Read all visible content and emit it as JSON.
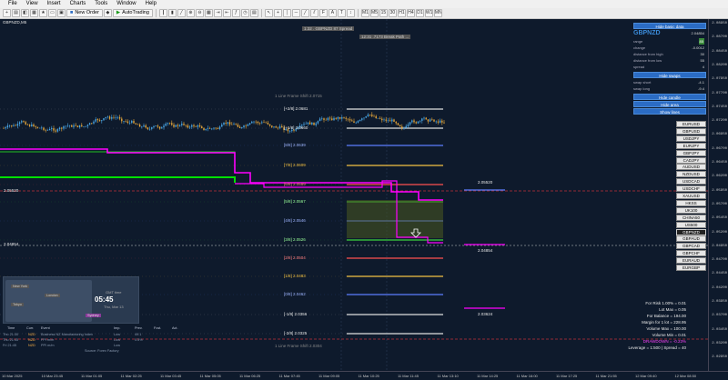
{
  "menu": [
    "File",
    "View",
    "Insert",
    "Charts",
    "Tools",
    "Window",
    "Help"
  ],
  "toolbar": {
    "new_order": "New Order",
    "autotrading": "AutoTrading"
  },
  "chart": {
    "symbol": "GBPNZD,M5",
    "top_labels": [
      "1:32 . GBPNZD 87 Spread",
      "12:31 .7173 Break Path ..."
    ],
    "levels": [
      {
        "label": "[+2/8]  2.0681"
      },
      {
        "label": "[+1/8]  2.0660"
      },
      {
        "label": "[8/8]  2.0639"
      },
      {
        "label": "[7/8]  2.0609"
      },
      {
        "label": "[6/8]  2.0589"
      },
      {
        "label": "[5/8]  2.0567"
      },
      {
        "label": "[4/8]  2.0546"
      },
      {
        "label": "[3/8]  2.0526"
      },
      {
        "label": "[2/8]  2.0504"
      },
      {
        "label": "[1/8]  2.0483"
      },
      {
        "label": "[0/8]  2.0462"
      },
      {
        "label": "[-1/8]  2.0356"
      },
      {
        "label": "[-2/8]  2.0325"
      }
    ],
    "top_dim": "1 Line Frame Shift  2.0715",
    "bot_dim": "1 Line Frame Shift  2.0304",
    "price_right_1": "2.05520",
    "price_right_2": "2.04854",
    "price_right_3": "2.03624",
    "left_price_1": "2.05520",
    "left_price_2": "2.04854"
  },
  "panel": {
    "hide_basic": "Hide basic data",
    "pair_name": "GBPNZD",
    "pair_price": "2.04854",
    "rows": [
      {
        "label": "range",
        "value": "85"
      },
      {
        "label": "change",
        "value": "-0.0012"
      },
      {
        "label": "distance from high",
        "value": "30"
      },
      {
        "label": "distance from low",
        "value": "55"
      },
      {
        "label": "spread",
        "value": "4"
      }
    ],
    "hide_swaps": "Hide swaps",
    "swap_rows": [
      {
        "label": "swap short",
        "value": "-4.1"
      },
      {
        "label": "swap long",
        "value": "-9.4"
      }
    ],
    "hide_candle": "Hide candle",
    "hide_area": "Hide area",
    "show_lines": "Show lines"
  },
  "pairs": [
    "EURUSD",
    "GBPUSD",
    "USDJPY",
    "EURJPY",
    "GBPJPY",
    "CADJPY",
    "AUDUSD",
    "NZDUSD",
    "USDCAD",
    "USDCHF",
    "XAUUSD",
    "HKSS",
    "UK100",
    "CHINA50",
    "US500",
    "GBPNZD",
    "GBPAUD",
    "GBPCAD",
    "GBPCHF",
    "EURAUD",
    "EURGBP"
  ],
  "active_pair": "GBPNZD",
  "stats": [
    "For Risk 1.00% = 0.01",
    "Lot Max = 0.05",
    "For Balance = 194.00",
    "Margin for 1 lot = 228.95",
    "Volume Max = 100.00",
    "Volume Min = 0.01",
    "DRAWDOWN = -0.23%",
    "Leverage = 1:500 | Spread = 40"
  ],
  "clock": {
    "time": "05:45",
    "label": "GMT time",
    "date": "Thu, Mar 13",
    "cities": [
      "New York",
      "London",
      "Tokyo",
      "Sydney"
    ]
  },
  "news_header": [
    "Time",
    "Curr.",
    "Event",
    "Imp.",
    "Prev.",
    "Fcst.",
    "Act."
  ],
  "news_rows": [
    {
      "time": "Thu 21:30",
      "curr": "NZD",
      "event": "Business NZ Manufacturing Index",
      "imp": "Low",
      "prev": "49.1",
      "fcst": "",
      "act": ""
    },
    {
      "time": "Thu 21:45",
      "curr": "NZD",
      "event": "FPI m/m",
      "imp": "Low",
      "prev": "0.5%",
      "fcst": "",
      "act": ""
    },
    {
      "time": "Fri 21:45",
      "curr": "NZD",
      "event": "PPI m/m",
      "imp": "Low",
      "prev": "",
      "fcst": "",
      "act": ""
    }
  ],
  "news_footer": "Source: Forex Factory",
  "xaxis": [
    "10 Mar 2025",
    "10 Mar 23:45",
    "11 Mar 01:05",
    "11 Mar 02:25",
    "11 Mar 03:45",
    "11 Mar 05:05",
    "11 Mar 06:25",
    "11 Mar 07:45",
    "11 Mar 09:05",
    "11 Mar 10:25",
    "11 Mar 11:45",
    "11 Mar 13:10",
    "11 Mar 14:25",
    "11 Mar 16:00",
    "11 Mar 17:25",
    "11 Mar 21:55",
    "12 Mar 09:40",
    "12 Mar 08:50"
  ],
  "yaxis": [
    "2.08950",
    "2.08700",
    "2.08450",
    "2.08200",
    "2.07950",
    "2.07700",
    "2.07450",
    "2.07200",
    "2.06950",
    "2.06700",
    "2.06450",
    "2.06200",
    "2.05950",
    "2.05700",
    "2.05450",
    "2.05200",
    "2.04950",
    "2.04700",
    "2.04450",
    "2.04200",
    "2.03950",
    "2.03700",
    "2.03450",
    "2.03200",
    "2.02950"
  ],
  "colors": {
    "bg": "#0e1a2c",
    "magenta": "#ff00ff",
    "green": "#00ff00",
    "button": "#2b6cc4"
  }
}
